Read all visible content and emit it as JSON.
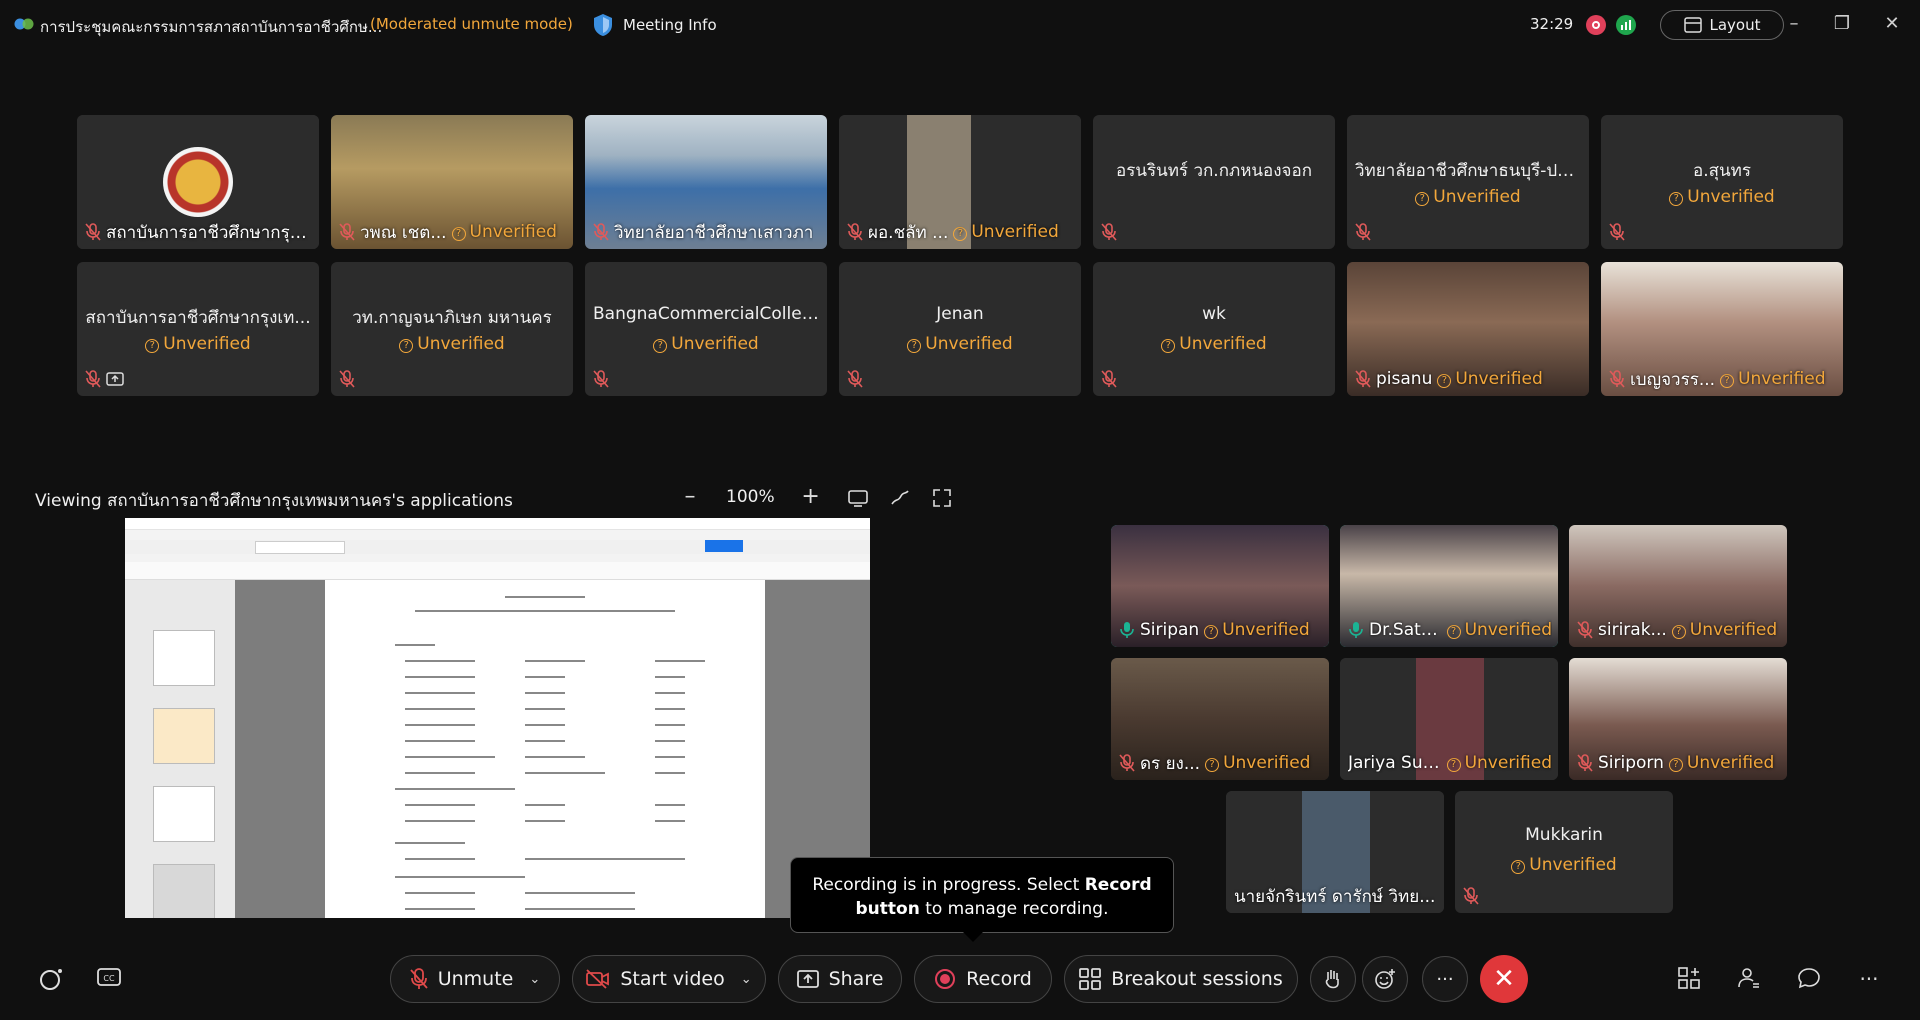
{
  "titlebar": {
    "title": "การประชุมคณะกรรมการสภาสถาบันการอาชีวศึกษ...",
    "mode": "(Moderated unmute mode)",
    "meeting_info": "Meeting Info",
    "timer": "32:29",
    "layout": "Layout"
  },
  "top_grid": [
    {
      "name": "สถาบันการอาชีวศึกษากรุง...",
      "status": "",
      "kind": "logo"
    },
    {
      "name": "วพณ เชต...",
      "status": "Unverified",
      "kind": "photo"
    },
    {
      "name": "วิทยาลัยอาชีวศึกษาเสาวภา",
      "status": "",
      "kind": "photo"
    },
    {
      "name": "ผอ.ชลัท ...",
      "status": "Unverified",
      "kind": "photo"
    },
    {
      "name": "อรนรินทร์ วก.กภหนองจอก",
      "status": "",
      "kind": "name"
    },
    {
      "name": "วิทยาลัยอาชีวศึกษาธนบุรี-ปริ...",
      "status": "Unverified",
      "kind": "name"
    },
    {
      "name": "อ.สุนทร",
      "status": "Unverified",
      "kind": "name"
    },
    {
      "name": "สถาบันการอาชีวศึกษากรุงเท...",
      "status": "Unverified",
      "kind": "name"
    },
    {
      "name": "วท.กาญจนาภิเษก มหานคร",
      "status": "Unverified",
      "kind": "name"
    },
    {
      "name": "BangnaCommercialCollege",
      "status": "Unverified",
      "kind": "name"
    },
    {
      "name": "Jenan",
      "status": "Unverified",
      "kind": "name"
    },
    {
      "name": "wk",
      "status": "Unverified",
      "kind": "name"
    },
    {
      "name": "pisanu",
      "status": "Unverified",
      "kind": "photo"
    },
    {
      "name": "เบญจวรร...",
      "status": "Unverified",
      "kind": "photo"
    }
  ],
  "share": {
    "viewing": "Viewing สถาบันการอาชีวศึกษากรุงเทพมหานคร's applications",
    "zoom": "100%"
  },
  "side_grid": [
    {
      "name": "Siripan",
      "status": "Unverified",
      "mic": "on"
    },
    {
      "name": "Dr.Sathian",
      "status": "Unverified",
      "mic": "on"
    },
    {
      "name": "sirirak...",
      "status": "Unverified",
      "mic": "off"
    },
    {
      "name": "ดร ยง...",
      "status": "Unverified",
      "mic": "off"
    },
    {
      "name": "Jariya Sut...",
      "status": "Unverified",
      "mic": "none"
    },
    {
      "name": "Siriporn",
      "status": "Unverified",
      "mic": "off"
    },
    {
      "name": "นายจักรินทร์ ดารักษ์ วิทย...",
      "status": "",
      "mic": "none"
    },
    {
      "name": "Mukkarin",
      "status": "Unverified",
      "mic": "off"
    }
  ],
  "tooltip": {
    "text1": "Recording is in progress. Select ",
    "bold1": "Record",
    "bold2": "button",
    "text2": " to manage recording."
  },
  "toolbar": {
    "unmute": "Unmute",
    "start_video": "Start video",
    "share": "Share",
    "record": "Record",
    "breakout": "Breakout sessions"
  },
  "colors": {
    "accent_warning": "#f2a73b",
    "active_speaker": "#1bb494",
    "end_call": "#e0373a"
  }
}
